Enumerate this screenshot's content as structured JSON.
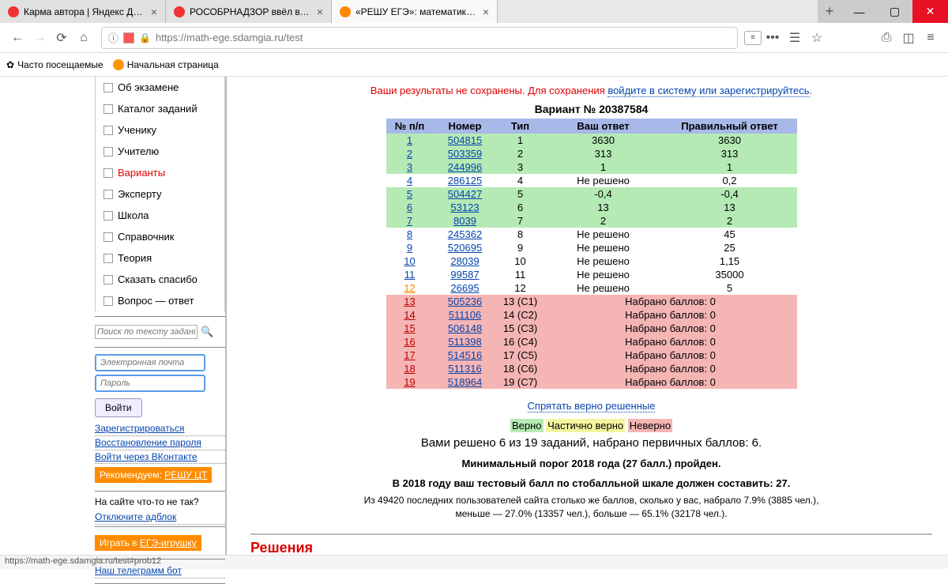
{
  "browser": {
    "tabs": [
      {
        "label": "Карма автора | Яндекс Дзен",
        "fav": "z"
      },
      {
        "label": "РОСОБРНАДЗОР ввёл всю ст…",
        "fav": "z"
      },
      {
        "label": "«РЕШУ ЕГЭ»: математика. ЕГЭ",
        "fav": "o",
        "active": true
      }
    ],
    "url": "https://math-ege.sdamgia.ru/test",
    "bookmarks": [
      "Часто посещаемые",
      "Начальная страница"
    ],
    "status": "https://math-ege.sdamgia.ru/test#prob12"
  },
  "sidebar": {
    "items": [
      {
        "label": "Об экзамене"
      },
      {
        "label": "Каталог заданий"
      },
      {
        "label": "Ученику"
      },
      {
        "label": "Учителю"
      },
      {
        "label": "Варианты",
        "active": true
      },
      {
        "label": "Эксперту"
      },
      {
        "label": "Школа"
      },
      {
        "label": "Справочник"
      },
      {
        "label": "Теория"
      },
      {
        "label": "Сказать спасибо"
      },
      {
        "label": "Вопрос — ответ"
      }
    ],
    "search_placeholder": "Поиск по тексту задания",
    "login": {
      "email": "Электронная почта",
      "pass": "Пароль",
      "button": "Войти",
      "register": "Зарегистрироваться",
      "restore": "Восстановление пароля",
      "vk": "Войти через ВКонтакте"
    },
    "promo1": {
      "prefix": "Рекомендуем: ",
      "link": "РЕШУ ЦТ"
    },
    "adblock": {
      "q": "На сайте что-то не так?",
      "link": "Отключите адблок"
    },
    "promo2": {
      "prefix": "Играть в ",
      "link": "ЕГЭ-игрушку"
    },
    "telegram": "Наш телеграмм бот"
  },
  "main": {
    "warn_red": "Ваши результаты не сохранены. Для сохранения ",
    "warn_link": "войдите в систему или зарегистрируйтесь",
    "variant": "Вариант № 20387584",
    "cols": [
      "№ п/п",
      "Номер",
      "Тип",
      "Ваш ответ",
      "Правильный ответ"
    ],
    "rows": [
      {
        "pp": "1",
        "num": "504815",
        "type": "1",
        "ans": "3630",
        "cor": "3630",
        "cls": "green"
      },
      {
        "pp": "2",
        "num": "503359",
        "type": "2",
        "ans": "313",
        "cor": "313",
        "cls": "green"
      },
      {
        "pp": "3",
        "num": "244996",
        "type": "3",
        "ans": "1",
        "cor": "1",
        "cls": "green"
      },
      {
        "pp": "4",
        "num": "286125",
        "type": "4",
        "ans": "Не решено",
        "cor": "0,2",
        "cls": ""
      },
      {
        "pp": "5",
        "num": "504427",
        "type": "5",
        "ans": "-0,4",
        "cor": "-0,4",
        "cls": "green"
      },
      {
        "pp": "6",
        "num": "53123",
        "type": "6",
        "ans": "13",
        "cor": "13",
        "cls": "green"
      },
      {
        "pp": "7",
        "num": "8039",
        "type": "7",
        "ans": "2",
        "cor": "2",
        "cls": "green"
      },
      {
        "pp": "8",
        "num": "245362",
        "type": "8",
        "ans": "Не решено",
        "cor": "45",
        "cls": ""
      },
      {
        "pp": "9",
        "num": "520695",
        "type": "9",
        "ans": "Не решено",
        "cor": "25",
        "cls": ""
      },
      {
        "pp": "10",
        "num": "28039",
        "type": "10",
        "ans": "Не решено",
        "cor": "1,15",
        "cls": ""
      },
      {
        "pp": "11",
        "num": "99587",
        "type": "11",
        "ans": "Не решено",
        "cor": "35000",
        "cls": ""
      },
      {
        "pp": "12",
        "num": "26695",
        "type": "12",
        "ans": "Не решено",
        "cor": "5",
        "cls": "",
        "pporange": true
      },
      {
        "pp": "13",
        "num": "505236",
        "type": "13 (С1)",
        "ans": "",
        "cor": "Набрано баллов: 0",
        "cls": "pink",
        "merge": true
      },
      {
        "pp": "14",
        "num": "511106",
        "type": "14 (С2)",
        "ans": "",
        "cor": "Набрано баллов: 0",
        "cls": "pink",
        "merge": true
      },
      {
        "pp": "15",
        "num": "506148",
        "type": "15 (С3)",
        "ans": "",
        "cor": "Набрано баллов: 0",
        "cls": "pink",
        "merge": true
      },
      {
        "pp": "16",
        "num": "511398",
        "type": "16 (С4)",
        "ans": "",
        "cor": "Набрано баллов: 0",
        "cls": "pink",
        "merge": true
      },
      {
        "pp": "17",
        "num": "514516",
        "type": "17 (С5)",
        "ans": "",
        "cor": "Набрано баллов: 0",
        "cls": "pink",
        "merge": true
      },
      {
        "pp": "18",
        "num": "511316",
        "type": "18 (С6)",
        "ans": "",
        "cor": "Набрано баллов: 0",
        "cls": "pink",
        "merge": true
      },
      {
        "pp": "19",
        "num": "518964",
        "type": "19 (С7)",
        "ans": "",
        "cor": "Набрано баллов: 0",
        "cls": "pink",
        "merge": true
      }
    ],
    "hide": "Спрятать верно решенные",
    "legend": {
      "g": "Верно",
      "y": "Частично верно",
      "p": "Неверно"
    },
    "summary": "Вами решено 6 из 19 заданий, набрано первичных баллов: 6.",
    "threshold": "Минимальный порог 2018 года (27 балл.) пройден.",
    "score": "В 2018 году ваш тестовый балл по стобалльной шкале должен составить: 27.",
    "stats": "Из 49420 последних пользователей сайта столько же баллов, сколько у вас, набрало 7.9% (3885 чел.),\nменьше — 27.0% (13357 чел.), больше — 65.1% (32178 чел.).",
    "solutions": "Решения"
  }
}
